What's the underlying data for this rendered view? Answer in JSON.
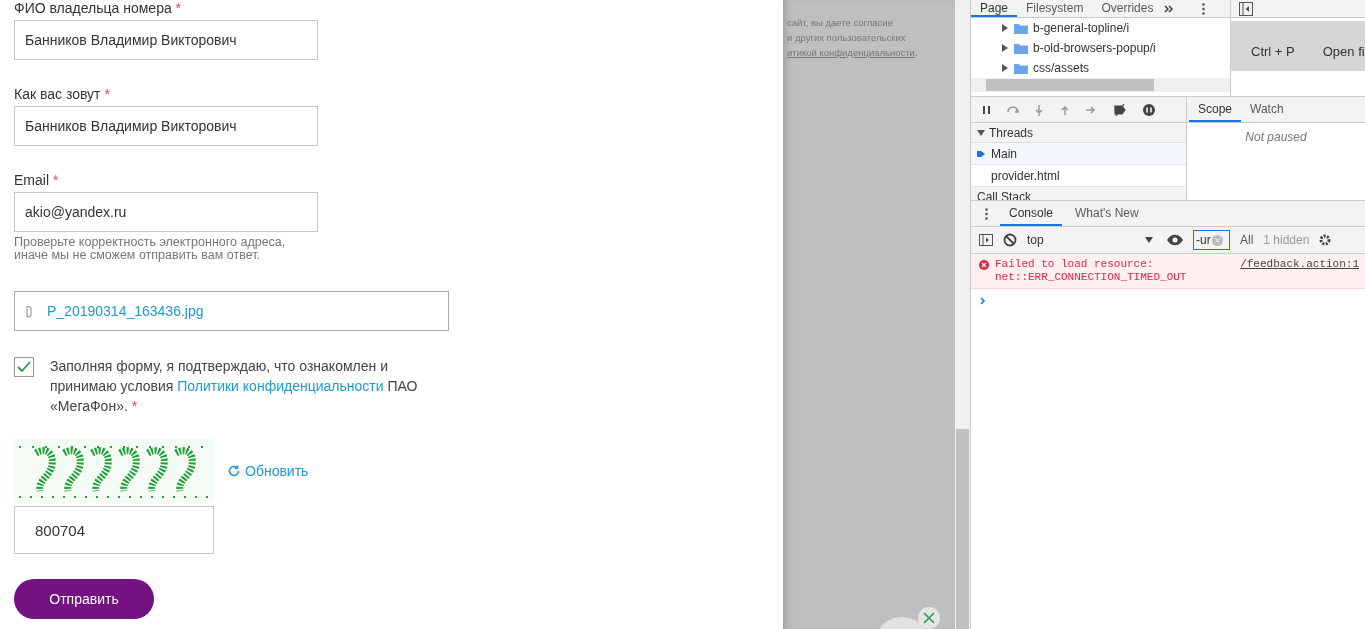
{
  "form": {
    "fields": [
      {
        "label": "ФИО владельца номера",
        "required_mark": "*",
        "value": "Банников Владимир Викторович"
      },
      {
        "label": "Как вас зовут",
        "required_mark": "*",
        "value": "Банников Владимир Викторович"
      },
      {
        "label": "Email",
        "required_mark": "*",
        "value": "akio@yandex.ru",
        "hint": "Проверьте корректность электронного адреса,\nиначе мы не сможем отправить вам ответ."
      }
    ],
    "attachment": {
      "file_name": "P_20190314_163436.jpg"
    },
    "consent": {
      "checked": true,
      "text_before": "Заполняя форму, я подтверждаю, что ознакомлен и принимаю условия ",
      "link": "Политики конфиденциальности",
      "text_after": " ПАО «МегаФон».",
      "required_mark": "*"
    },
    "captcha": {
      "kind": "picture",
      "refresh_label": "Обновить",
      "value": "800704"
    },
    "submit_label": "Отправить"
  },
  "overlay": {
    "lines": [
      "сайт, вы даете согласие",
      "и других пользовательских"
    ],
    "link": "итикой конфиденциальности",
    "link_end": "."
  },
  "devtools": {
    "sources_tabs": [
      {
        "label": "Page",
        "selected": true
      },
      {
        "label": "Filesystem",
        "selected": false
      },
      {
        "label": "Overrides",
        "selected": false
      }
    ],
    "file_tree": [
      {
        "name": "b-general-topline/i",
        "expanded": false
      },
      {
        "name": "b-old-browsers-popup/i",
        "expanded": false
      },
      {
        "name": "css/assets",
        "expanded": false
      }
    ],
    "editor_hint": {
      "shortcut": "Ctrl + P",
      "action": "Open fi"
    },
    "threads": {
      "header": "Threads",
      "expanded": true,
      "items": [
        {
          "name": "Main",
          "selected": true
        },
        {
          "name": "provider.html",
          "selected": false
        }
      ]
    },
    "call_stack_header": "Call Stack",
    "scope_tabs": [
      {
        "label": "Scope",
        "selected": true
      },
      {
        "label": "Watch",
        "selected": false
      }
    ],
    "scope_message": "Not paused",
    "drawer_tabs": [
      {
        "label": "Console",
        "selected": true
      },
      {
        "label": "What's New",
        "selected": false
      }
    ],
    "console_toolbar": {
      "context": "top",
      "filter": "-ur",
      "levels": "All",
      "hidden_count": "1 hidden"
    },
    "messages": [
      {
        "kind": "error",
        "text": "Failed to load resource:\nnet::ERR_CONNECTION_TIMED_OUT",
        "source": "/feedback.action:1"
      }
    ]
  }
}
